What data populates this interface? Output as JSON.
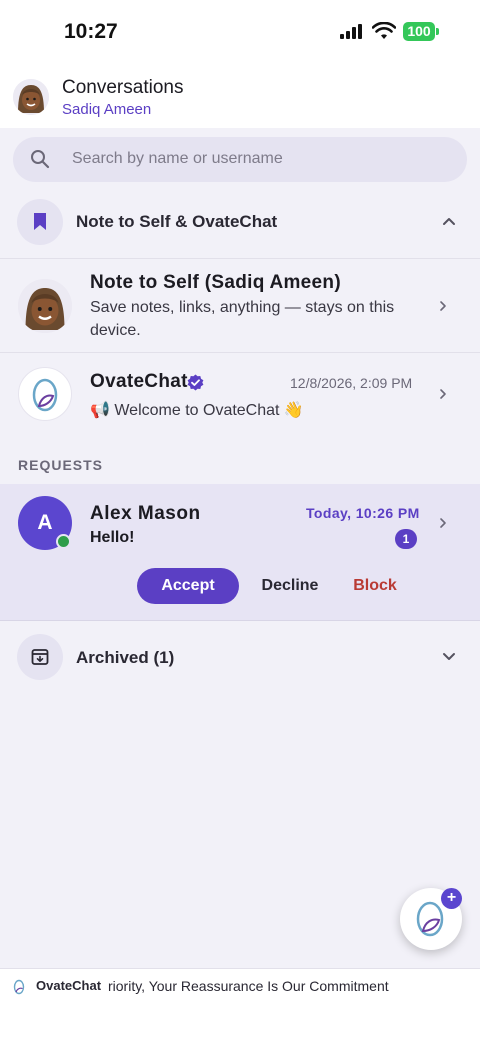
{
  "status_bar": {
    "time": "10:27",
    "battery": "100"
  },
  "header": {
    "title": "Conversations",
    "subtitle": "Sadiq Ameen"
  },
  "search": {
    "placeholder": "Search by name or username"
  },
  "sections": {
    "pinned": {
      "title": "Note to Self & OvateChat",
      "icon": "bookmark-icon"
    },
    "requests": {
      "label": "REQUESTS"
    },
    "archived": {
      "title": "Archived (1)",
      "icon": "archive-icon"
    }
  },
  "conversations": [
    {
      "title": "Note to Self (Sadiq Ameen)",
      "preview": "Save notes, links, anything — stays on this device."
    },
    {
      "title": "OvateChat",
      "verified": true,
      "time": "12/8/2026, 2:09 PM",
      "preview": "📢 Welcome to OvateChat 👋"
    }
  ],
  "request": {
    "initial": "A",
    "name": "Alex Mason",
    "time": "Today, 10:26 PM",
    "message": "Hello!",
    "unread": "1",
    "online": true,
    "actions": {
      "accept": "Accept",
      "decline": "Decline",
      "block": "Block"
    }
  },
  "fab": {
    "icon": "new-chat-icon",
    "badge": "+"
  },
  "footer": {
    "brand": "OvateChat",
    "ticker": "riority, Your Reassurance  Is Our Commitment"
  },
  "colors": {
    "accent": "#5b3fc4",
    "block": "#b93a34",
    "online": "#2e9d4a",
    "battery": "#34c759"
  }
}
